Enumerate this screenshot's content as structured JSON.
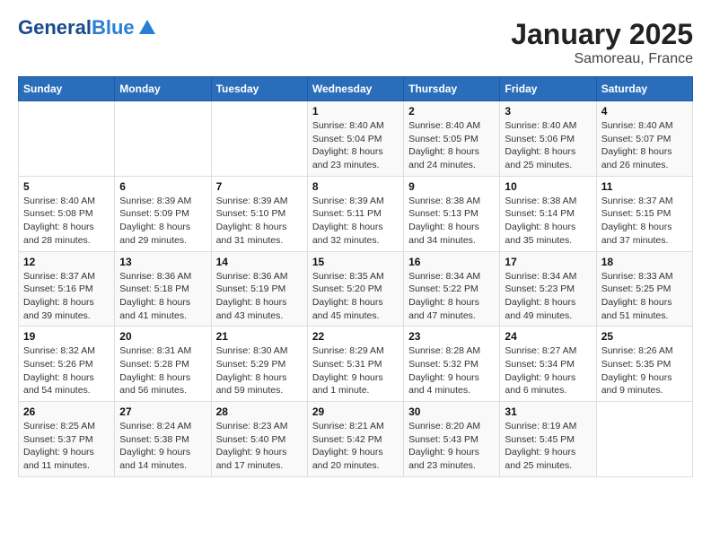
{
  "logo": {
    "general": "General",
    "blue": "Blue"
  },
  "title": "January 2025",
  "subtitle": "Samoreau, France",
  "days_header": [
    "Sunday",
    "Monday",
    "Tuesday",
    "Wednesday",
    "Thursday",
    "Friday",
    "Saturday"
  ],
  "weeks": [
    [
      {
        "num": "",
        "info": ""
      },
      {
        "num": "",
        "info": ""
      },
      {
        "num": "",
        "info": ""
      },
      {
        "num": "1",
        "info": "Sunrise: 8:40 AM\nSunset: 5:04 PM\nDaylight: 8 hours\nand 23 minutes."
      },
      {
        "num": "2",
        "info": "Sunrise: 8:40 AM\nSunset: 5:05 PM\nDaylight: 8 hours\nand 24 minutes."
      },
      {
        "num": "3",
        "info": "Sunrise: 8:40 AM\nSunset: 5:06 PM\nDaylight: 8 hours\nand 25 minutes."
      },
      {
        "num": "4",
        "info": "Sunrise: 8:40 AM\nSunset: 5:07 PM\nDaylight: 8 hours\nand 26 minutes."
      }
    ],
    [
      {
        "num": "5",
        "info": "Sunrise: 8:40 AM\nSunset: 5:08 PM\nDaylight: 8 hours\nand 28 minutes."
      },
      {
        "num": "6",
        "info": "Sunrise: 8:39 AM\nSunset: 5:09 PM\nDaylight: 8 hours\nand 29 minutes."
      },
      {
        "num": "7",
        "info": "Sunrise: 8:39 AM\nSunset: 5:10 PM\nDaylight: 8 hours\nand 31 minutes."
      },
      {
        "num": "8",
        "info": "Sunrise: 8:39 AM\nSunset: 5:11 PM\nDaylight: 8 hours\nand 32 minutes."
      },
      {
        "num": "9",
        "info": "Sunrise: 8:38 AM\nSunset: 5:13 PM\nDaylight: 8 hours\nand 34 minutes."
      },
      {
        "num": "10",
        "info": "Sunrise: 8:38 AM\nSunset: 5:14 PM\nDaylight: 8 hours\nand 35 minutes."
      },
      {
        "num": "11",
        "info": "Sunrise: 8:37 AM\nSunset: 5:15 PM\nDaylight: 8 hours\nand 37 minutes."
      }
    ],
    [
      {
        "num": "12",
        "info": "Sunrise: 8:37 AM\nSunset: 5:16 PM\nDaylight: 8 hours\nand 39 minutes."
      },
      {
        "num": "13",
        "info": "Sunrise: 8:36 AM\nSunset: 5:18 PM\nDaylight: 8 hours\nand 41 minutes."
      },
      {
        "num": "14",
        "info": "Sunrise: 8:36 AM\nSunset: 5:19 PM\nDaylight: 8 hours\nand 43 minutes."
      },
      {
        "num": "15",
        "info": "Sunrise: 8:35 AM\nSunset: 5:20 PM\nDaylight: 8 hours\nand 45 minutes."
      },
      {
        "num": "16",
        "info": "Sunrise: 8:34 AM\nSunset: 5:22 PM\nDaylight: 8 hours\nand 47 minutes."
      },
      {
        "num": "17",
        "info": "Sunrise: 8:34 AM\nSunset: 5:23 PM\nDaylight: 8 hours\nand 49 minutes."
      },
      {
        "num": "18",
        "info": "Sunrise: 8:33 AM\nSunset: 5:25 PM\nDaylight: 8 hours\nand 51 minutes."
      }
    ],
    [
      {
        "num": "19",
        "info": "Sunrise: 8:32 AM\nSunset: 5:26 PM\nDaylight: 8 hours\nand 54 minutes."
      },
      {
        "num": "20",
        "info": "Sunrise: 8:31 AM\nSunset: 5:28 PM\nDaylight: 8 hours\nand 56 minutes."
      },
      {
        "num": "21",
        "info": "Sunrise: 8:30 AM\nSunset: 5:29 PM\nDaylight: 8 hours\nand 59 minutes."
      },
      {
        "num": "22",
        "info": "Sunrise: 8:29 AM\nSunset: 5:31 PM\nDaylight: 9 hours\nand 1 minute."
      },
      {
        "num": "23",
        "info": "Sunrise: 8:28 AM\nSunset: 5:32 PM\nDaylight: 9 hours\nand 4 minutes."
      },
      {
        "num": "24",
        "info": "Sunrise: 8:27 AM\nSunset: 5:34 PM\nDaylight: 9 hours\nand 6 minutes."
      },
      {
        "num": "25",
        "info": "Sunrise: 8:26 AM\nSunset: 5:35 PM\nDaylight: 9 hours\nand 9 minutes."
      }
    ],
    [
      {
        "num": "26",
        "info": "Sunrise: 8:25 AM\nSunset: 5:37 PM\nDaylight: 9 hours\nand 11 minutes."
      },
      {
        "num": "27",
        "info": "Sunrise: 8:24 AM\nSunset: 5:38 PM\nDaylight: 9 hours\nand 14 minutes."
      },
      {
        "num": "28",
        "info": "Sunrise: 8:23 AM\nSunset: 5:40 PM\nDaylight: 9 hours\nand 17 minutes."
      },
      {
        "num": "29",
        "info": "Sunrise: 8:21 AM\nSunset: 5:42 PM\nDaylight: 9 hours\nand 20 minutes."
      },
      {
        "num": "30",
        "info": "Sunrise: 8:20 AM\nSunset: 5:43 PM\nDaylight: 9 hours\nand 23 minutes."
      },
      {
        "num": "31",
        "info": "Sunrise: 8:19 AM\nSunset: 5:45 PM\nDaylight: 9 hours\nand 25 minutes."
      },
      {
        "num": "",
        "info": ""
      }
    ]
  ]
}
